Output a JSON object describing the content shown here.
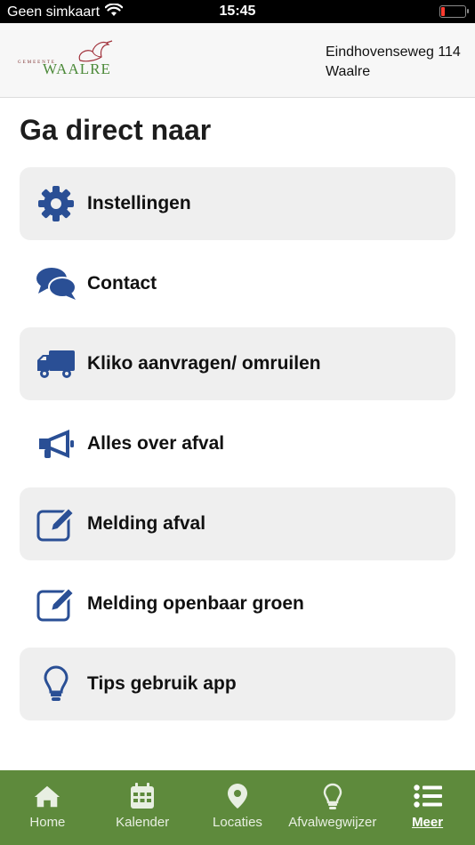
{
  "status_bar": {
    "carrier": "Geen simkaart",
    "time": "15:45",
    "battery_color": "#ff3b30"
  },
  "header": {
    "logo": {
      "subtitle": "GEMEENTE",
      "name": "WAALRE"
    },
    "address_line1": "Eindhovenseweg 114",
    "address_line2": "Waalre"
  },
  "page": {
    "title": "Ga direct naar"
  },
  "menu": {
    "icon_color": "#2a4f95",
    "items": [
      {
        "label": "Instellingen",
        "icon": "gear-icon"
      },
      {
        "label": "Contact",
        "icon": "chat-bubbles-icon"
      },
      {
        "label": "Kliko aanvragen/ omruilen",
        "icon": "truck-icon"
      },
      {
        "label": "Alles over afval",
        "icon": "megaphone-icon"
      },
      {
        "label": "Melding afval",
        "icon": "edit-icon"
      },
      {
        "label": "Melding openbaar groen",
        "icon": "edit-icon"
      },
      {
        "label": "Tips gebruik app",
        "icon": "lightbulb-icon"
      }
    ]
  },
  "tab_bar": {
    "background": "#5e8a3c",
    "tabs": [
      {
        "label": "Home",
        "icon": "home-icon"
      },
      {
        "label": "Kalender",
        "icon": "calendar-icon"
      },
      {
        "label": "Locaties",
        "icon": "map-pin-icon"
      },
      {
        "label": "Afvalwegwijzer",
        "icon": "lightbulb-icon"
      },
      {
        "label": "Meer",
        "icon": "list-icon",
        "active": true
      }
    ]
  }
}
